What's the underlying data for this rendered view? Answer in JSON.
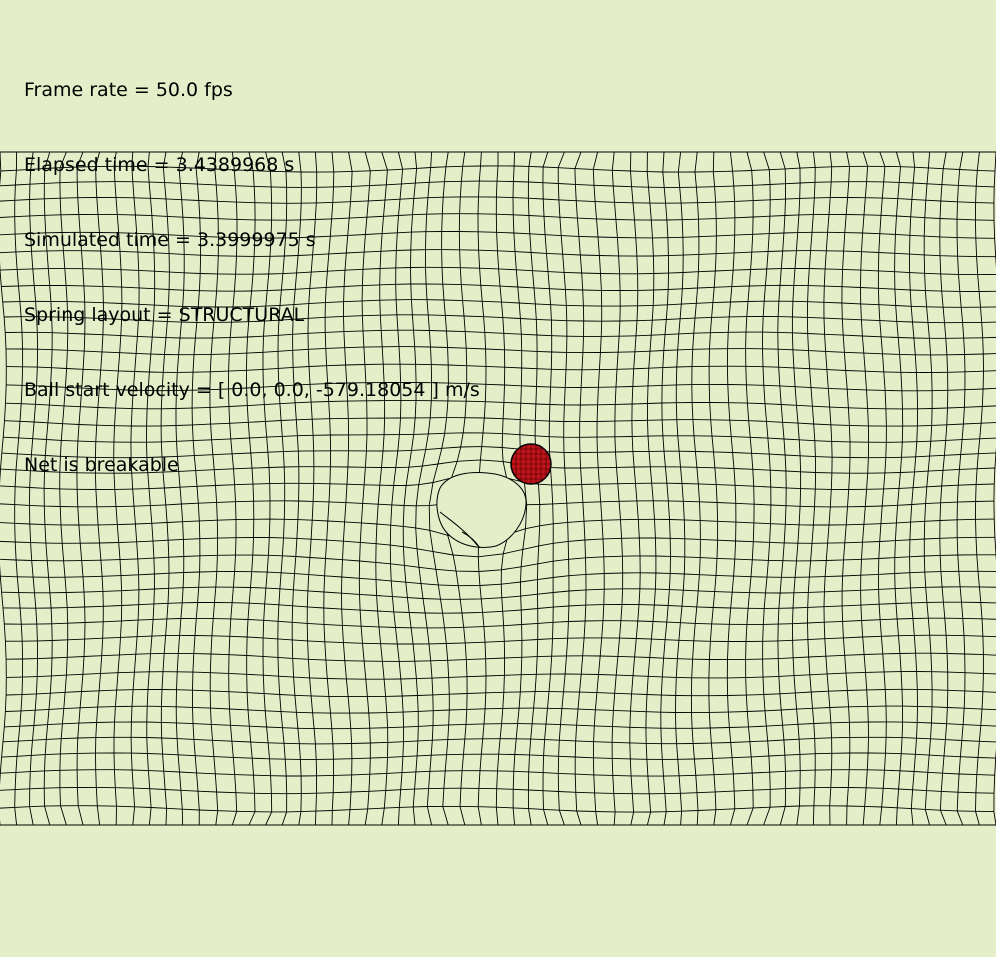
{
  "hud": {
    "frame_rate": "Frame rate = 50.0 fps",
    "elapsed_time": "Elapsed time = 3.4389968 s",
    "simulated_time": "Simulated time = 3.3999975 s",
    "spring_layout": "Spring layout = STRUCTURAL",
    "ball_start_velocity": "Ball start velocity = [ 0.0, 0.0, -579.18054 ] m/s",
    "net_status": "Net is breakable"
  },
  "colors": {
    "background": "#e4efc9",
    "net_line": "#000000",
    "ball_fill": "#c0141a",
    "ball_outline": "#000000",
    "hole_fill": "#e4efc9"
  },
  "scene": {
    "net_icon": "deformed-spring-net",
    "ball_icon": "red-ball",
    "hole_icon": "torn-net-hole"
  }
}
